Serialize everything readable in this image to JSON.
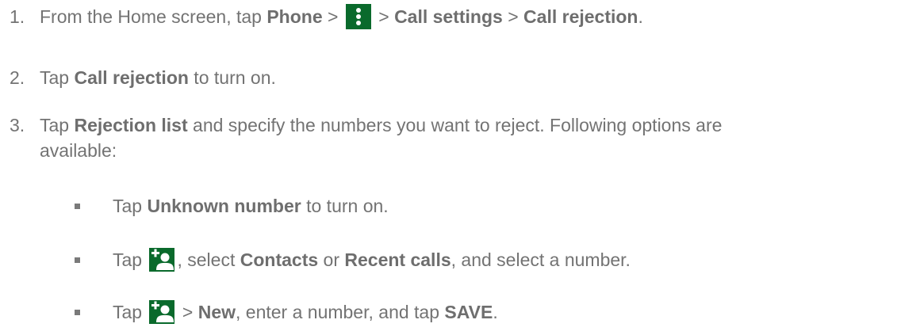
{
  "steps": [
    {
      "number": "1.",
      "prefix": "From the Home screen, tap ",
      "phone": "Phone",
      "sep1": " > ",
      "sep2": " > ",
      "call_settings": "Call settings",
      "sep3": " > ",
      "call_rejection": "Call rejection",
      "end": "."
    },
    {
      "number": "2.",
      "prefix": "Tap ",
      "call_rejection": "Call rejection",
      "suffix": " to turn on."
    },
    {
      "number": "3.",
      "prefix": "Tap ",
      "rejection_list": "Rejection list",
      "suffix": " and specify the numbers you want to reject. Following options are",
      "line2": "available:"
    }
  ],
  "bullets": [
    {
      "prefix": "Tap ",
      "unknown_number": "Unknown number",
      "suffix": " to turn on."
    },
    {
      "prefix": "Tap ",
      "mid1": ", select ",
      "contacts": "Contacts",
      "mid2": " or ",
      "recent_calls": "Recent calls",
      "suffix": ", and select a number."
    },
    {
      "prefix": "Tap ",
      "sep": " > ",
      "new": "New",
      "mid": ", enter a number, and tap ",
      "save": "SAVE",
      "end": "."
    }
  ],
  "icons": {
    "menu": "more-vert-icon",
    "add_contact": "add-contact-icon"
  },
  "colors": {
    "icon_green": "#0a6a2c",
    "text": "#737373"
  }
}
